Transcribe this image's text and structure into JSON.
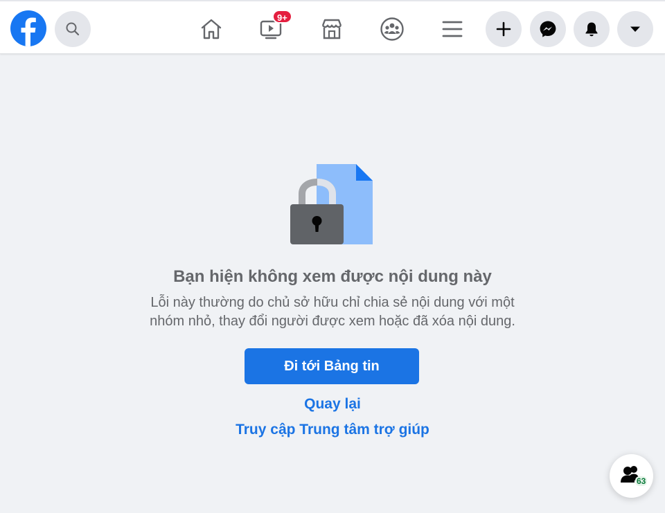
{
  "nav": {
    "watch_badge": "9+"
  },
  "icons": {
    "logo": "facebook-logo-icon",
    "search": "search-icon",
    "home": "home-icon",
    "watch": "watch-video-icon",
    "marketplace": "marketplace-store-icon",
    "groups": "groups-icon",
    "menu": "menu-hamburger-icon",
    "create": "plus-icon",
    "messenger": "messenger-icon",
    "notifications": "bell-icon",
    "account": "caret-down-icon",
    "contacts": "contacts-people-icon"
  },
  "colors": {
    "brand": "#1877f2",
    "button": "#1b74e4",
    "badge": "#e41e3f",
    "background": "#f0f2f5",
    "text_secondary": "#65676b"
  },
  "message": {
    "title": "Bạn hiện không xem được nội dung này",
    "line1": "Lỗi này thường do chủ sở hữu chỉ chia sẻ nội dung với một",
    "line2": "nhóm nhỏ, thay đổi người được xem hoặc đã xóa nội dung."
  },
  "actions": {
    "go_to_feed": "Đi tới Bảng tin",
    "go_back": "Quay lại",
    "help_center": "Truy cập Trung tâm trợ giúp"
  },
  "contacts": {
    "count": "63"
  }
}
